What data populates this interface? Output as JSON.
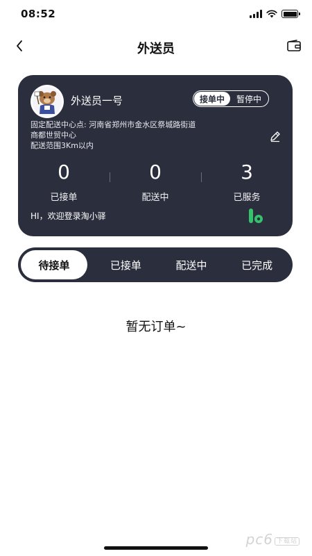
{
  "status_bar": {
    "time": "08:52"
  },
  "nav": {
    "title": "外送员",
    "back_icon": "chevron-left-icon",
    "wallet_icon": "wallet-icon"
  },
  "card": {
    "name": "外送员一号",
    "toggle": {
      "on_label": "接单中",
      "off_label": "暂停中"
    },
    "address_line1": "固定配送中心点: 河南省郑州市金水区祭城路街道",
    "address_line2": "商都世贸中心",
    "range": "配送范围3Km以内",
    "stats": [
      {
        "value": "0",
        "label": "已接单"
      },
      {
        "value": "0",
        "label": "配送中"
      },
      {
        "value": "3",
        "label": "已服务"
      }
    ],
    "welcome": "HI，欢迎登录淘小驿",
    "brand_color": "#34c26b"
  },
  "tabs": [
    {
      "label": "待接单",
      "active": true
    },
    {
      "label": "已接单",
      "active": false
    },
    {
      "label": "配送中",
      "active": false
    },
    {
      "label": "已完成",
      "active": false
    }
  ],
  "empty_state": "暂无订单~",
  "watermark": {
    "text": "pc6",
    "badge": "下载站"
  },
  "colors": {
    "card_bg": "#2b2e3c",
    "text": "#111111"
  }
}
